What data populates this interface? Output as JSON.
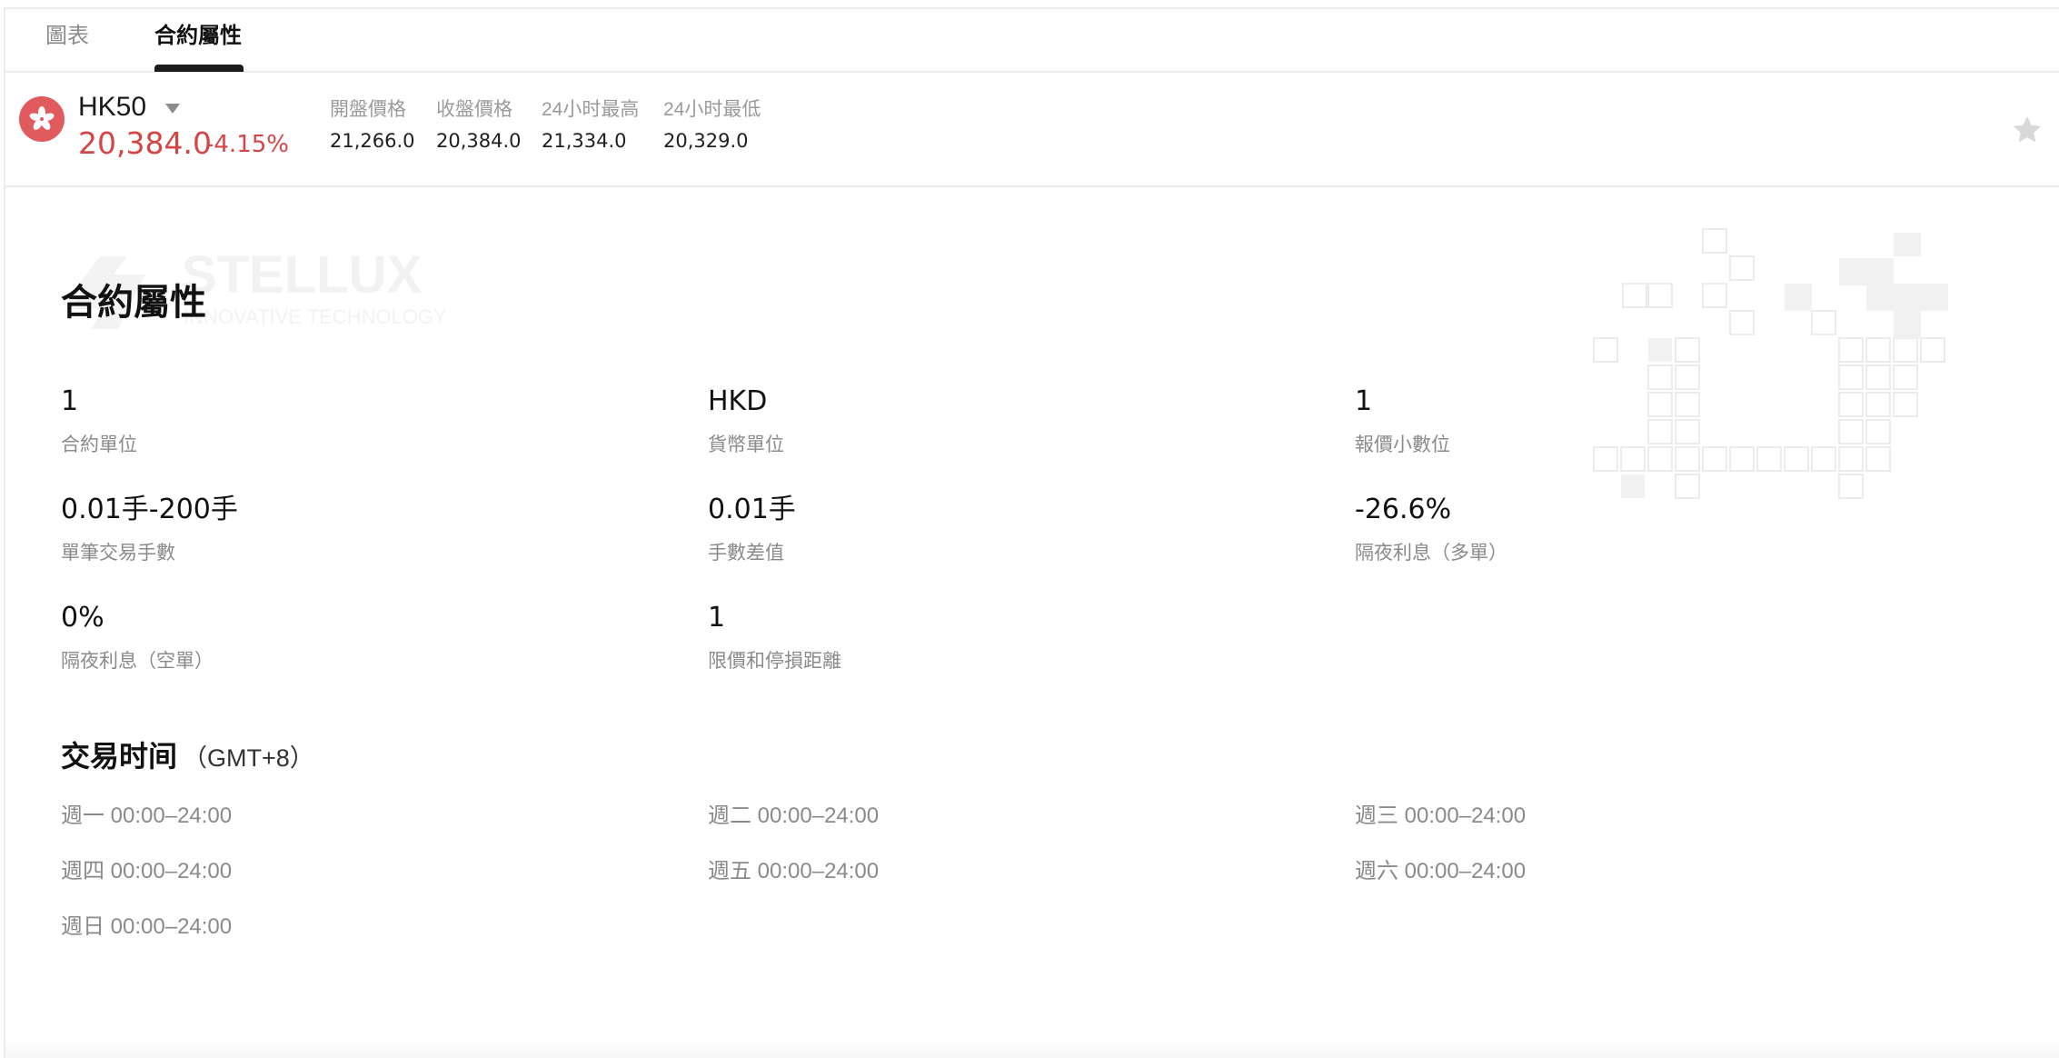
{
  "tabs": [
    {
      "label": "圖表",
      "active": false
    },
    {
      "label": "合約屬性",
      "active": true
    }
  ],
  "ticker": {
    "flag_icon": "hong-kong-flag-icon",
    "symbol": "HK50",
    "price": "20,384.0",
    "change": "-4.15%",
    "price_color": "#d64545",
    "stats": [
      {
        "label": "開盤價格",
        "value": "21,266.0"
      },
      {
        "label": "收盤價格",
        "value": "20,384.0"
      },
      {
        "label": "24小时最高",
        "value": "21,334.0"
      },
      {
        "label": "24小时最低",
        "value": "20,329.0"
      }
    ]
  },
  "watermark": {
    "brand": "STELLUX",
    "tagline": "INNOVATIVE TECHNOLOGY"
  },
  "contract": {
    "title": "合約屬性",
    "items": [
      {
        "value": "1",
        "label": "合約單位"
      },
      {
        "value": "HKD",
        "label": "貨幣單位"
      },
      {
        "value": "1",
        "label": "報價小數位"
      },
      {
        "value": "0.01手-200手",
        "label": "單筆交易手數"
      },
      {
        "value": "0.01手",
        "label": "手數差值"
      },
      {
        "value": "-26.6%",
        "label": "隔夜利息（多單）"
      },
      {
        "value": "0%",
        "label": "隔夜利息（空單）"
      },
      {
        "value": "1",
        "label": "限價和停損距離"
      }
    ]
  },
  "trading_hours": {
    "title": "交易时间",
    "timezone": "（GMT+8）",
    "days": [
      "週一 00:00–24:00",
      "週二 00:00–24:00",
      "週三 00:00–24:00",
      "週四 00:00–24:00",
      "週五 00:00–24:00",
      "週六 00:00–24:00",
      "週日 00:00–24:00"
    ]
  }
}
